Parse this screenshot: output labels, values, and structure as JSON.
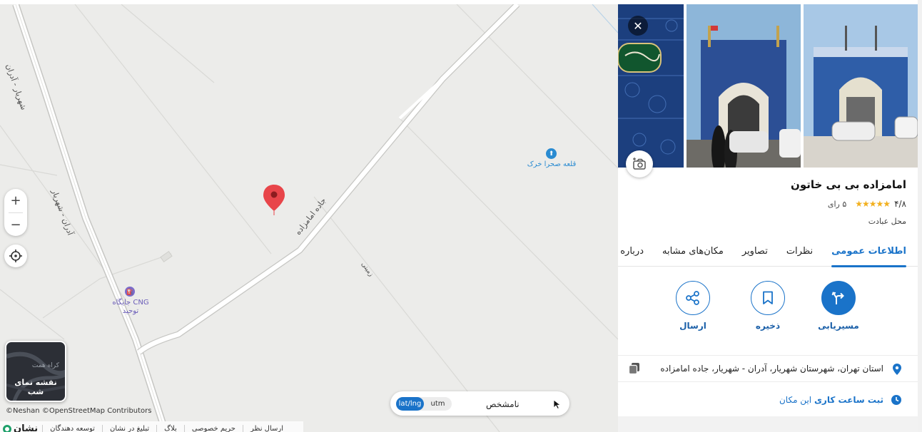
{
  "map": {
    "road_labels": [
      "شهریار - آدران",
      "آدران - شهریار",
      "جاده امامزاده",
      "زمینی"
    ],
    "pois": [
      {
        "name": "قلعه صحرا خرک",
        "color": "#2a8bd1",
        "icon": "historic-site-icon"
      },
      {
        "name_line1": "جایگاه CNG",
        "name_line2": "توحید",
        "color": "#7b6bc9",
        "icon": "fuel-station-icon"
      }
    ],
    "marker_color": "#e8454a",
    "zoom_in_label": "+",
    "zoom_out_label": "−",
    "night_tile": {
      "label": "نقشه نمای شب",
      "preview_text": "کراه همت"
    },
    "attribution": "©Neshan  ©OpenStreetMap Contributors",
    "footer": {
      "brand": "نشان",
      "links": [
        "توسعه دهندگان",
        "تبلیغ در نشان",
        "بلاگ",
        "حریم خصوصی",
        "ارسال نظر"
      ]
    },
    "coords": {
      "options": [
        "lat/lng",
        "utm"
      ],
      "active": "lat/lng",
      "value": "نامشخص"
    }
  },
  "panel": {
    "close_label": "✕",
    "title": "امامزاده بی بی خاتون",
    "rating": "۴/۸",
    "stars": 5,
    "votes": "۵ رای",
    "category": "محل عبادت",
    "tabs": [
      "اطلاعات عمومی",
      "نظرات",
      "تصاویر",
      "مکان‌های مشابه",
      "درباره"
    ],
    "active_tab": "اطلاعات عمومی",
    "actions": {
      "route": "مسیریابی",
      "save": "ذخیره",
      "share": "ارسال"
    },
    "address": "استان تهران، شهرستان شهریار، آدران - شهریار، جاده امامزاده",
    "hours_bold": "ثبت ساعت کاری",
    "hours_rest": " این مکان"
  },
  "colors": {
    "accent": "#1a73c9",
    "marker": "#e8454a",
    "map_bg": "#ececea"
  }
}
